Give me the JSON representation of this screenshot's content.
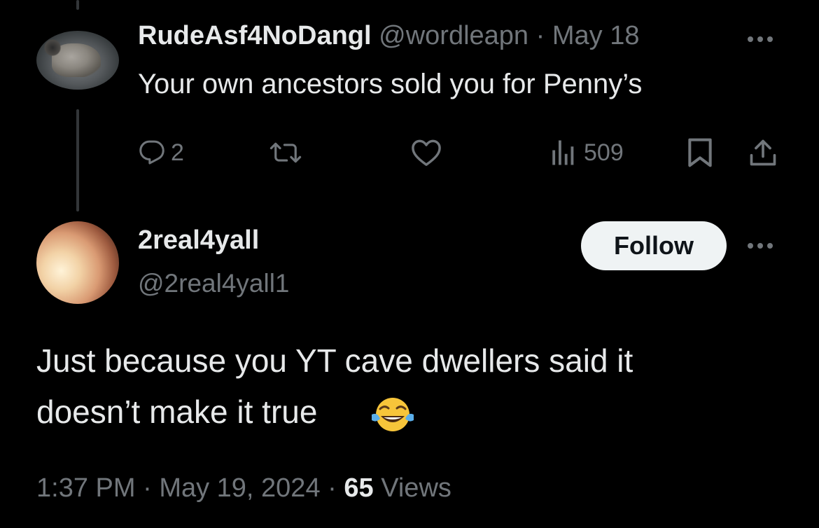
{
  "parent_tweet": {
    "display_name": "RudeAsf4NoDangl",
    "handle": "@wordleapn",
    "separator": "·",
    "date": "May 18",
    "text": "Your own ancestors sold you for Penny’s",
    "replies": "2",
    "views": "509"
  },
  "reply_tweet": {
    "display_name": "2real4yall",
    "handle": "@2real4yall1",
    "follow_label": "Follow",
    "text_line1": "Just because you YT cave dwellers said it",
    "text_line2": "doesn’t make it true",
    "emoji": "face-with-tears-of-joy-emoji",
    "time": "1:37 PM",
    "dot1": "·",
    "date": "May 19, 2024",
    "dot2": "·",
    "views_count": "65",
    "views_label": "Views"
  },
  "colors": {
    "background": "#000000",
    "text": "#e7e9ea",
    "muted": "#71767b",
    "follow_bg": "#eff3f4"
  }
}
